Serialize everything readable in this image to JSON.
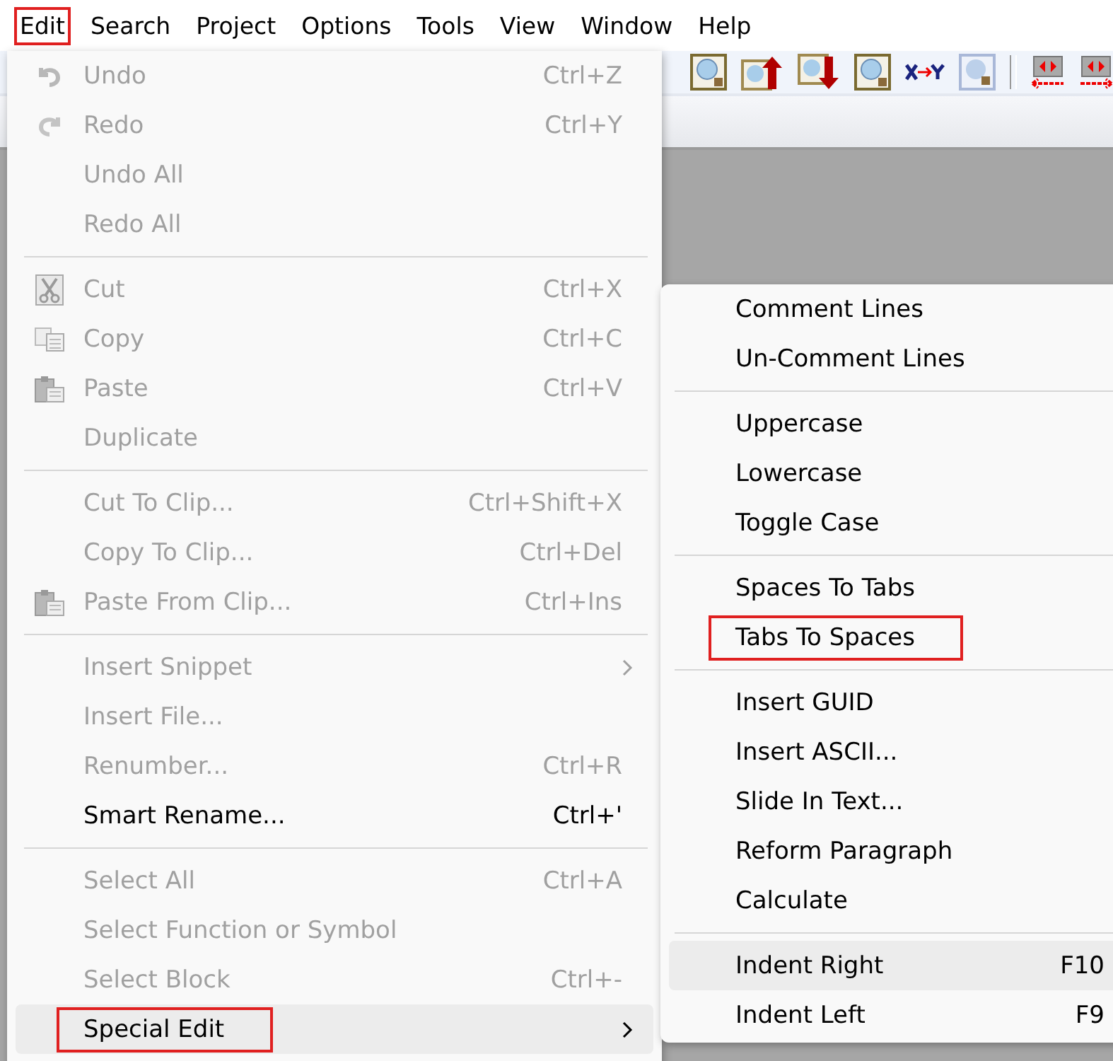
{
  "menubar": [
    {
      "label": "Edit",
      "annotated": true
    },
    {
      "label": "Search",
      "annotated": false
    },
    {
      "label": "Project",
      "annotated": false
    },
    {
      "label": "Options",
      "annotated": false
    },
    {
      "label": "Tools",
      "annotated": false
    },
    {
      "label": "View",
      "annotated": false
    },
    {
      "label": "Window",
      "annotated": false
    },
    {
      "label": "Help",
      "annotated": false
    }
  ],
  "edit_menu": [
    {
      "kind": "item",
      "label": "Undo",
      "shortcut": "Ctrl+Z",
      "disabled": true,
      "highlighted": false,
      "annotated": false,
      "submenu": false
    },
    {
      "kind": "item",
      "label": "Redo",
      "shortcut": "Ctrl+Y",
      "disabled": true,
      "highlighted": false,
      "annotated": false,
      "submenu": false
    },
    {
      "kind": "item",
      "label": "Undo All",
      "disabled": true,
      "highlighted": false,
      "annotated": false,
      "submenu": false
    },
    {
      "kind": "item",
      "label": "Redo All",
      "disabled": true,
      "highlighted": false,
      "annotated": false,
      "submenu": false
    },
    {
      "kind": "separator"
    },
    {
      "kind": "item",
      "label": "Cut",
      "shortcut": "Ctrl+X",
      "disabled": true,
      "highlighted": false,
      "annotated": false,
      "submenu": false
    },
    {
      "kind": "item",
      "label": "Copy",
      "shortcut": "Ctrl+C",
      "disabled": true,
      "highlighted": false,
      "annotated": false,
      "submenu": false
    },
    {
      "kind": "item",
      "label": "Paste",
      "shortcut": "Ctrl+V",
      "disabled": true,
      "highlighted": false,
      "annotated": false,
      "submenu": false
    },
    {
      "kind": "item",
      "label": "Duplicate",
      "disabled": true,
      "highlighted": false,
      "annotated": false,
      "submenu": false
    },
    {
      "kind": "separator"
    },
    {
      "kind": "item",
      "label": "Cut To Clip...",
      "shortcut": "Ctrl+Shift+X",
      "disabled": true,
      "highlighted": false,
      "annotated": false,
      "submenu": false
    },
    {
      "kind": "item",
      "label": "Copy To Clip...",
      "shortcut": "Ctrl+Del",
      "disabled": true,
      "highlighted": false,
      "annotated": false,
      "submenu": false
    },
    {
      "kind": "item",
      "label": "Paste From Clip...",
      "shortcut": "Ctrl+Ins",
      "disabled": true,
      "highlighted": false,
      "annotated": false,
      "submenu": false
    },
    {
      "kind": "separator"
    },
    {
      "kind": "item",
      "label": "Insert Snippet",
      "disabled": true,
      "highlighted": false,
      "annotated": false,
      "submenu": true
    },
    {
      "kind": "item",
      "label": "Insert File...",
      "disabled": true,
      "highlighted": false,
      "annotated": false,
      "submenu": false
    },
    {
      "kind": "item",
      "label": "Renumber...",
      "shortcut": "Ctrl+R",
      "disabled": true,
      "highlighted": false,
      "annotated": false,
      "submenu": false
    },
    {
      "kind": "item",
      "label": "Smart Rename...",
      "shortcut": "Ctrl+'",
      "disabled": false,
      "highlighted": false,
      "annotated": false,
      "submenu": false
    },
    {
      "kind": "separator"
    },
    {
      "kind": "item",
      "label": "Select All",
      "shortcut": "Ctrl+A",
      "disabled": true,
      "highlighted": false,
      "annotated": false,
      "submenu": false
    },
    {
      "kind": "item",
      "label": "Select Function or Symbol",
      "disabled": true,
      "highlighted": false,
      "annotated": false,
      "submenu": false
    },
    {
      "kind": "item",
      "label": "Select Block",
      "shortcut": "Ctrl+-",
      "disabled": true,
      "highlighted": false,
      "annotated": false,
      "submenu": false
    },
    {
      "kind": "item",
      "label": "Special Edit",
      "disabled": false,
      "highlighted": true,
      "annotated": true,
      "submenu": true
    }
  ],
  "special_edit_menu": [
    {
      "kind": "item",
      "label": "Comment Lines",
      "disabled": false,
      "highlighted": false,
      "annotated": false
    },
    {
      "kind": "item",
      "label": "Un-Comment Lines",
      "disabled": false,
      "highlighted": false,
      "annotated": false
    },
    {
      "kind": "separator"
    },
    {
      "kind": "item",
      "label": "Uppercase",
      "disabled": false,
      "highlighted": false,
      "annotated": false
    },
    {
      "kind": "item",
      "label": "Lowercase",
      "disabled": false,
      "highlighted": false,
      "annotated": false
    },
    {
      "kind": "item",
      "label": "Toggle Case",
      "disabled": false,
      "highlighted": false,
      "annotated": false
    },
    {
      "kind": "separator"
    },
    {
      "kind": "item",
      "label": "Spaces To Tabs",
      "disabled": false,
      "highlighted": false,
      "annotated": false
    },
    {
      "kind": "item",
      "label": "Tabs To Spaces",
      "disabled": false,
      "highlighted": false,
      "annotated": true
    },
    {
      "kind": "separator"
    },
    {
      "kind": "item",
      "label": "Insert GUID",
      "disabled": false,
      "highlighted": false,
      "annotated": false
    },
    {
      "kind": "item",
      "label": "Insert ASCII...",
      "disabled": false,
      "highlighted": false,
      "annotated": false
    },
    {
      "kind": "item",
      "label": "Slide In Text...",
      "disabled": false,
      "highlighted": false,
      "annotated": false
    },
    {
      "kind": "item",
      "label": "Reform Paragraph",
      "disabled": false,
      "highlighted": false,
      "annotated": false
    },
    {
      "kind": "item",
      "label": "Calculate",
      "disabled": false,
      "highlighted": false,
      "annotated": false
    },
    {
      "kind": "separator"
    },
    {
      "kind": "item",
      "label": "Indent Right",
      "shortcut": "F10",
      "disabled": false,
      "highlighted": true,
      "annotated": false
    },
    {
      "kind": "item",
      "label": "Indent Left",
      "shortcut": "F9",
      "disabled": false,
      "highlighted": false,
      "annotated": false
    }
  ]
}
